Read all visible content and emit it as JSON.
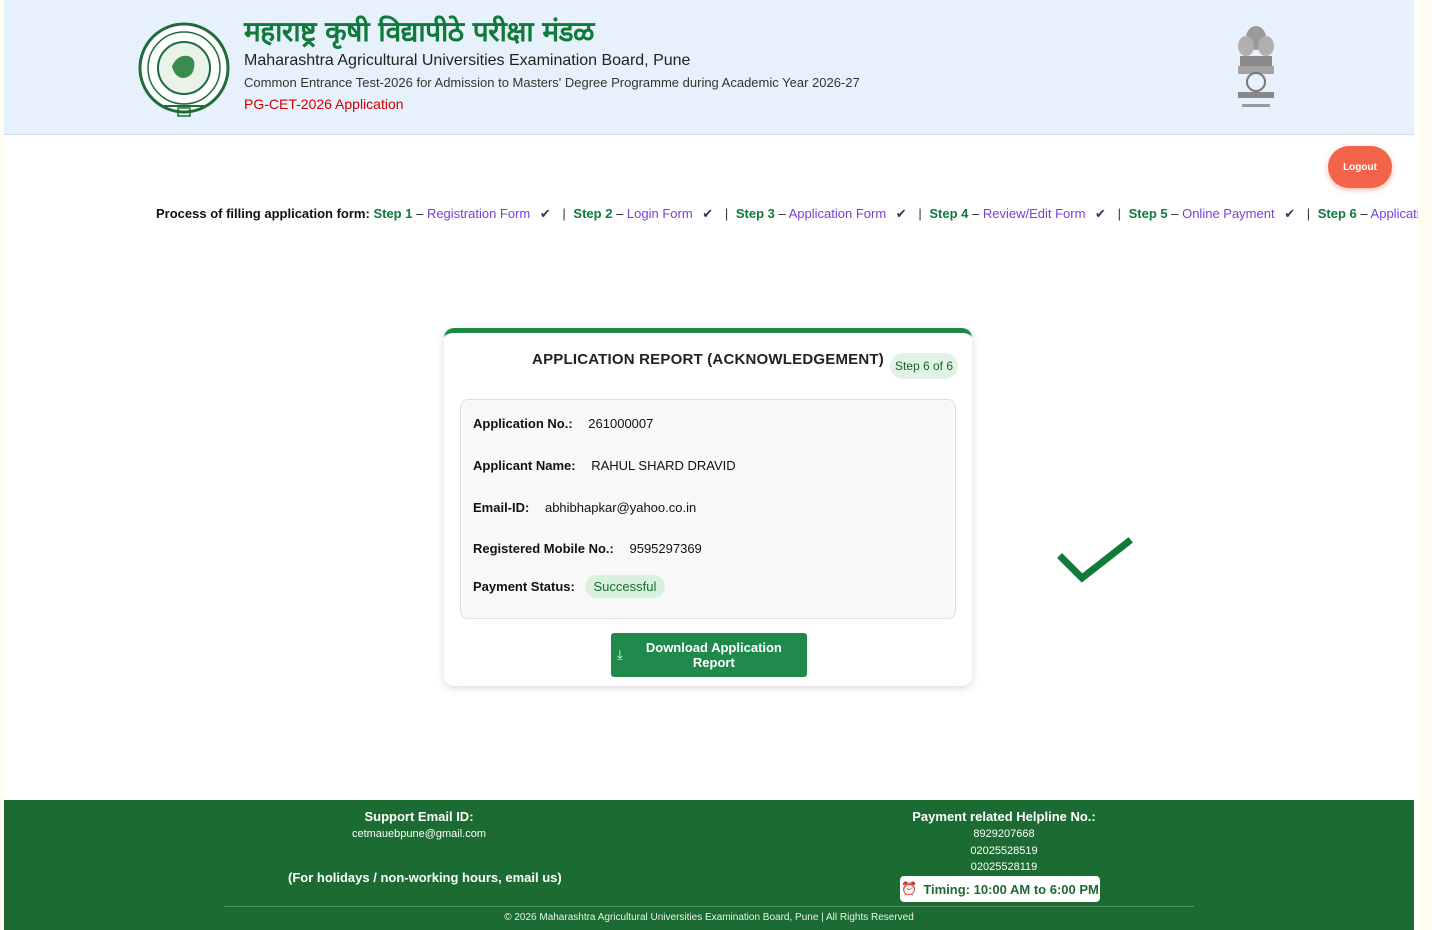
{
  "header": {
    "marathi_title": "महाराष्ट्र कृषी विद्यापीठे परीक्षा मंडळ",
    "english_title": "Maharashtra Agricultural Universities Examination Board, Pune",
    "subtitle": "Common Entrance Test-2026 for Admission to Masters' Degree Programme during Academic Year 2026-27",
    "application_title": "PG-CET-2026 Application",
    "logo_icon": "university-seal-icon",
    "emblem_icon": "national-emblem-icon"
  },
  "logout_label": "Logout",
  "process": {
    "label": "Process of filling application form:",
    "steps": [
      {
        "num": "Step 1",
        "name": "Registration Form"
      },
      {
        "num": "Step 2",
        "name": "Login Form"
      },
      {
        "num": "Step 3",
        "name": "Application Form"
      },
      {
        "num": "Step 4",
        "name": "Review/Edit Form"
      },
      {
        "num": "Step 5",
        "name": "Online Payment"
      },
      {
        "num": "Step 6",
        "name": "Application Report"
      }
    ],
    "check": "✔",
    "sep": "|",
    "dash": "–"
  },
  "report": {
    "title": "APPLICATION REPORT (ACKNOWLEDGEMENT)",
    "step_badge": "Step 6 of 6",
    "fields": {
      "application_no": {
        "label": "Application No.:",
        "value": "261000007"
      },
      "applicant_name": {
        "label": "Applicant Name:",
        "value": "RAHUL SHARD DRAVID"
      },
      "email": {
        "label": "Email-ID:",
        "value": "abhibhapkar@yahoo.co.in"
      },
      "mobile": {
        "label": "Registered Mobile No.:",
        "value": "9595297369"
      },
      "payment": {
        "label": "Payment Status:",
        "value": "Successful"
      }
    },
    "download_label": "Download Application Report",
    "download_icon": "⤓"
  },
  "footer": {
    "support_heading": "Support Email ID:",
    "support_email": "cetmauebpune@gmail.com",
    "note": "(For holidays / non-working hours, email us)",
    "helpline_heading": "Payment related Helpline No.:",
    "phones": [
      "8929207668",
      "02025528519",
      "02025528119"
    ],
    "timing": "Timing: 10:00 AM to 6:00 PM",
    "timing_icon": "⏰",
    "copyright": "© 2026 Maharashtra Agricultural Universities Examination Board, Pune | All Rights Reserved"
  },
  "colors": {
    "brand_green": "#0f7a3a",
    "footer_green": "#1c6b32",
    "logout_red": "#f2634a",
    "header_bg": "#e7f1fb",
    "step_purple": "#7a3fd6"
  }
}
